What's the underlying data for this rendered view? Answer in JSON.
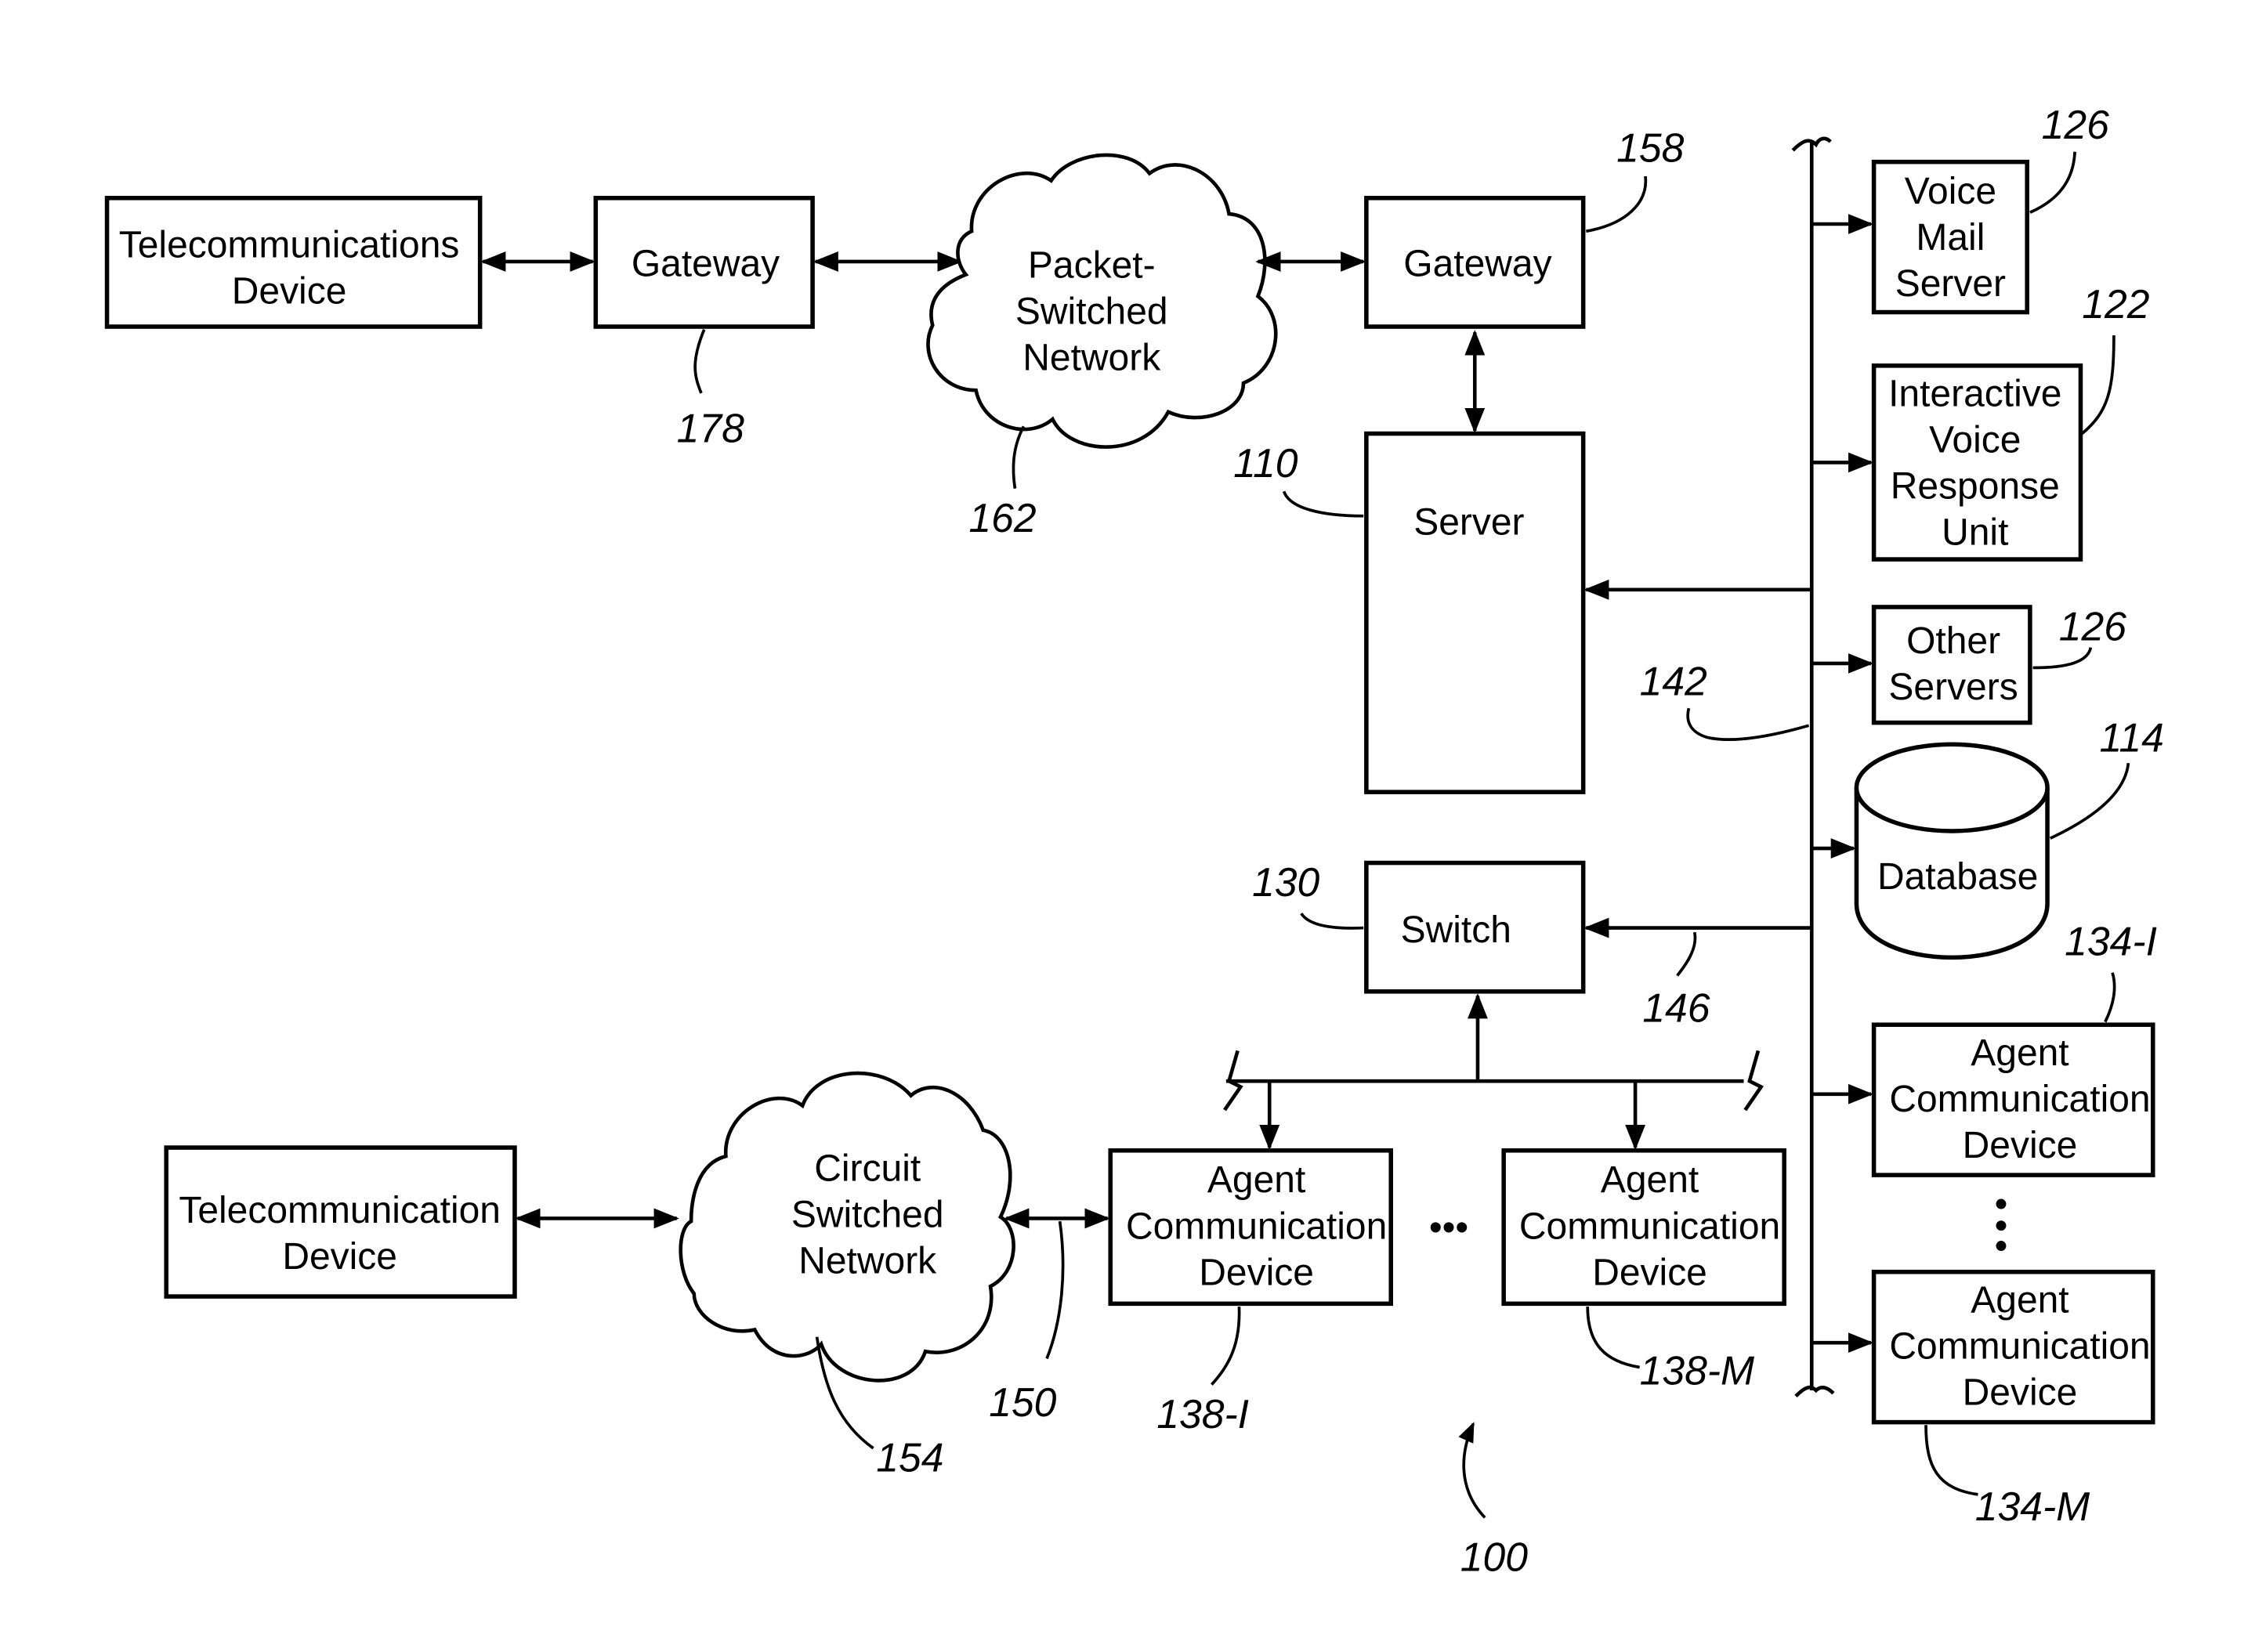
{
  "figure": {
    "figure_ref": "100",
    "nodes": {
      "telecom_device_top": {
        "lines": [
          "Telecommunications",
          "Device"
        ]
      },
      "gateway_left": {
        "lines": [
          "Gateway"
        ],
        "ref": "178"
      },
      "packet_network": {
        "lines": [
          "Packet-",
          "Switched",
          "Network"
        ],
        "ref": "162"
      },
      "gateway_right": {
        "lines": [
          "Gateway"
        ],
        "ref": "158"
      },
      "server": {
        "lines": [
          "Server"
        ],
        "ref": "110"
      },
      "voice_mail": {
        "lines": [
          "Voice",
          "Mail",
          "Server"
        ],
        "ref": "126"
      },
      "ivr": {
        "lines": [
          "Interactive",
          "Voice",
          "Response",
          "Unit"
        ],
        "ref": "122"
      },
      "other_servers": {
        "lines": [
          "Other",
          "Servers"
        ],
        "ref": "126"
      },
      "database": {
        "lines": [
          "Database"
        ],
        "ref": "114"
      },
      "switch": {
        "lines": [
          "Switch"
        ],
        "ref": "130"
      },
      "agent_right_1": {
        "lines": [
          "Agent",
          "Communication",
          "Device"
        ],
        "ref": "134-I"
      },
      "agent_right_m": {
        "lines": [
          "Agent",
          "Communication",
          "Device"
        ],
        "ref": "134-M"
      },
      "agent_bottom_1": {
        "lines": [
          "Agent",
          "Communication",
          "Device"
        ],
        "ref": "138-I"
      },
      "agent_bottom_m": {
        "lines": [
          "Agent",
          "Communication",
          "Device"
        ],
        "ref": "138-M"
      },
      "telecom_device_bottom": {
        "lines": [
          "Telecommunication",
          "Device"
        ]
      },
      "circuit_network": {
        "lines": [
          "Circuit",
          "Switched",
          "Network"
        ],
        "ref": "154"
      }
    },
    "links": {
      "lan_bus": "142",
      "switch_link": "146",
      "trunk_link": "150"
    },
    "ellipsis": "•••"
  }
}
